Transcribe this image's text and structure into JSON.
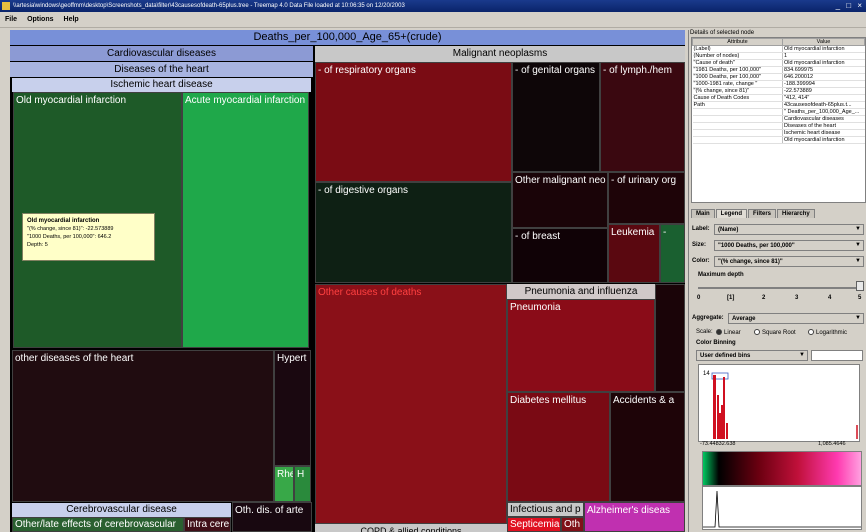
{
  "window": {
    "title": "\\\\artesia\\windows\\geoffmm\\desktop\\Screenshots_data\\filter\\43causesofdeath-65plus.tree - Treemap 4.0        Data File loaded at 10:06:35 on 12/20/2003",
    "controls": "_ □ ×"
  },
  "menu": {
    "file": "File",
    "options": "Options",
    "help": "Help"
  },
  "treemap": {
    "root": "Deaths_per_100,000_Age_65+(crude)",
    "cardio": "Cardiovascular diseases",
    "heart": "Diseases of the heart",
    "ischemic": "Ischemic heart disease",
    "old_mi": "Old myocardial infarction",
    "acute_mi": "Acute myocardial infarction",
    "other_heart": "other diseases of the heart",
    "hypert": "Hypert",
    "rhe": "Rhe",
    "h": "H",
    "cerebro": "Cerebrovascular disease",
    "other_late": "Other/late effects of cerebrovascular",
    "intra_cere": "Intra cere",
    "oth_arte": "Oth. dis. of arte",
    "malignant": "Malignant neoplasms",
    "respiratory": "- of respiratory organs",
    "genital": "- of genital organs",
    "lymph": "- of lymph./hem",
    "digestive": "- of digestive organs",
    "other_malig": "Other malignant neo",
    "urinary": "- of urinary org",
    "breast": "- of breast",
    "leukemia": "Leukemia",
    "dash": "-",
    "other_causes": "Other causes of deaths",
    "pneumonia_grp": "Pneumonia and influenza",
    "pneumonia": "Pneumonia",
    "diabetes": "Diabetes mellitus",
    "accidents": "Accidents & a",
    "infectious": "Infectious and p",
    "septicemia": "Septicemia",
    "oth": "Oth",
    "alzheimers": "Alzheimer's diseas",
    "copd": "COPD & allied conditions"
  },
  "tooltip": {
    "title": "Old myocardial infarction",
    "line1": "\"(% change, since 81)\": -22.573889",
    "line2": "\"1000 Deaths, per 100,000\": 646.2",
    "line3": "Depth: 5"
  },
  "details": {
    "title": "Details of selected node",
    "col_attr": "Attribute",
    "col_value": "Value",
    "rows": [
      {
        "k": "(Label)",
        "v": "Old myocardial infarction"
      },
      {
        "k": "(Number of nodes)",
        "v": "1"
      },
      {
        "k": "\"Cause of death\"",
        "v": "Old myocardial infarction"
      },
      {
        "k": "\"1981 Deaths, per 100,000\"",
        "v": "834.699975"
      },
      {
        "k": "\"1000 Deaths, per 100,000\"",
        "v": "646.200012"
      },
      {
        "k": "\"1000-1981 rate, change \"",
        "v": "-188.399994"
      },
      {
        "k": "\"(% change, since 81)\"",
        "v": "-22.573889"
      },
      {
        "k": "Cause of Death Codes",
        "v": "\"412, 414\""
      },
      {
        "k": "Path",
        "v": "43causesofdeath-65plus.t..."
      },
      {
        "k": "",
        "v": "\" Deaths_per_100,000_Age_..."
      },
      {
        "k": "",
        "v": "Cardiovascular diseases"
      },
      {
        "k": "",
        "v": "Diseases of the heart"
      },
      {
        "k": "",
        "v": "Ischemic heart disease"
      },
      {
        "k": "",
        "v": "Old myocardial infarction"
      }
    ]
  },
  "tabs": [
    "Main",
    "Legend",
    "Filters",
    "Hierarchy"
  ],
  "controls": {
    "label_lbl": "Label:",
    "label_val": "(Name)",
    "size_lbl": "Size:",
    "size_val": "\"1000 Deaths, per 100,000\"",
    "color_lbl": "Color:",
    "color_val": "\"(% change, since 81)\"",
    "maxdepth_lbl": "Maximum depth",
    "ticks": [
      "0",
      "[1]",
      "2",
      "3",
      "4",
      "5"
    ],
    "aggregate_lbl": "Aggregate:",
    "aggregate_val": "Average",
    "scale_lbl": "Scale:",
    "scale_linear": "Linear",
    "scale_sqrt": "Square Root",
    "scale_log": "Logarithmic",
    "binning_lbl": "Color Binning",
    "binning_val": "User defined bins",
    "hist_min": "-73.44832.638",
    "hist_max": "1,085.4646",
    "hist_peak_label": "14"
  },
  "colors": {
    "dark_green": "#1e5a28",
    "bright_green": "#1fa84a",
    "dark_red": "#8a1018",
    "magenta": "#c030b0"
  }
}
